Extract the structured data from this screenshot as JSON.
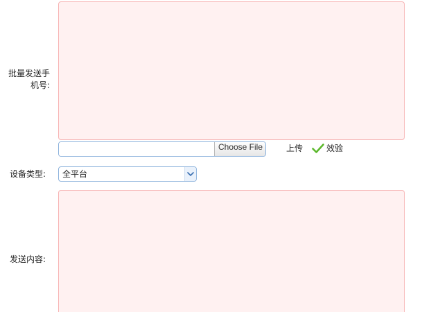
{
  "form": {
    "phones_label": "批量发送手机号:",
    "phones_value": "",
    "file": {
      "file_name": "",
      "choose_button_label": "Choose File"
    },
    "upload_label": "上传",
    "verify_label": "效验",
    "device_type_label": "设备类型:",
    "device_type_value": "全平台",
    "content_label": "发送内容:",
    "content_value": ""
  },
  "icons": {
    "verify": "checkmark-icon",
    "select_arrow": "chevron-down-icon"
  },
  "colors": {
    "textarea_border": "#f7b5b5",
    "textarea_background": "#fff1f1",
    "input_border": "#8fb4dd",
    "checkmark": "#5cb82c"
  }
}
